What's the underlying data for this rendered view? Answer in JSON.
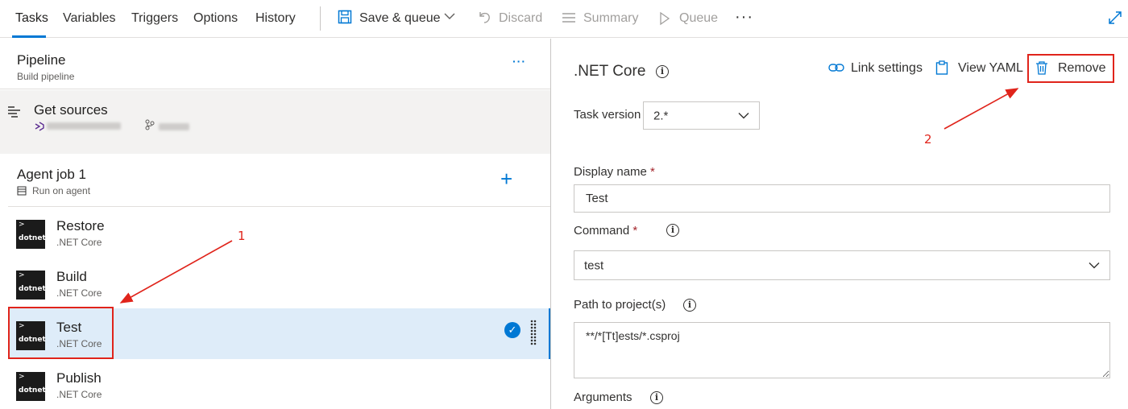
{
  "tabs": [
    {
      "label": "Tasks",
      "active": true
    },
    {
      "label": "Variables",
      "active": false
    },
    {
      "label": "Triggers",
      "active": false
    },
    {
      "label": "Options",
      "active": false
    },
    {
      "label": "History",
      "active": false
    }
  ],
  "toolbar": {
    "save_queue": "Save & queue",
    "discard": "Discard",
    "summary": "Summary",
    "queue": "Queue",
    "more": "···"
  },
  "pipeline": {
    "title": "Pipeline",
    "subtitle": "Build pipeline",
    "more": "···"
  },
  "sources": {
    "title": "Get sources"
  },
  "agent_job": {
    "title": "Agent job 1",
    "subtitle": "Run on agent",
    "add": "+"
  },
  "tasks": [
    {
      "name": "Restore",
      "type": ".NET Core",
      "selected": false
    },
    {
      "name": "Build",
      "type": ".NET Core",
      "selected": false
    },
    {
      "name": "Test",
      "type": ".NET Core",
      "selected": true
    },
    {
      "name": "Publish",
      "type": ".NET Core",
      "selected": false
    }
  ],
  "task_logo": {
    "chevron": ">",
    "text": "dotnet"
  },
  "detail": {
    "title": ".NET Core",
    "link_settings": "Link settings",
    "view_yaml": "View YAML",
    "remove": "Remove",
    "task_version_label": "Task version",
    "task_version_value": "2.*",
    "display_name_label": "Display name",
    "display_name_value": "Test",
    "command_label": "Command",
    "command_value": "test",
    "path_label": "Path to project(s)",
    "path_value": "**/*[Tt]ests/*.csproj",
    "arguments_label": "Arguments",
    "required_mark": "*"
  },
  "annotations": {
    "step1": "1",
    "step2": "2"
  },
  "colors": {
    "accent": "#0078d4",
    "selected_row": "#deecf9",
    "annotation": "#e0241b",
    "sources_bg": "#f3f2f1"
  }
}
